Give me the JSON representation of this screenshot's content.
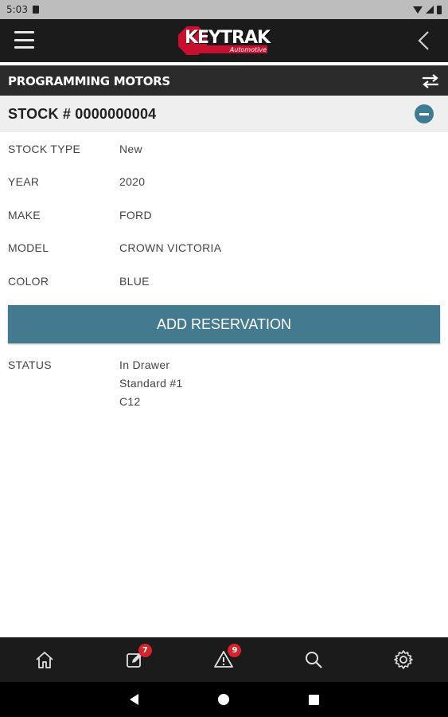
{
  "status_bar": {
    "time": "5:03"
  },
  "header": {
    "logo_text": "KEYTRAK",
    "logo_sub": "Automotive"
  },
  "dealer": {
    "name": "PROGRAMMING MOTORS"
  },
  "stock": {
    "title": "STOCK # 0000000004"
  },
  "details": [
    {
      "label": "STOCK TYPE",
      "value": "New"
    },
    {
      "label": "YEAR",
      "value": "2020"
    },
    {
      "label": "MAKE",
      "value": "FORD"
    },
    {
      "label": "MODEL",
      "value": "CROWN VICTORIA"
    },
    {
      "label": "COLOR",
      "value": "BLUE"
    }
  ],
  "reserve_button": {
    "label": "ADD RESERVATION"
  },
  "status": {
    "label": "STATUS",
    "lines": [
      "In Drawer",
      "Standard #1",
      "C12"
    ]
  },
  "bottom_nav": {
    "home": {
      "icon": "home-icon"
    },
    "tasks": {
      "icon": "edit-icon",
      "badge": "7"
    },
    "alerts": {
      "icon": "warning-icon",
      "badge": "9"
    },
    "search": {
      "icon": "search-icon"
    },
    "settings": {
      "icon": "gear-icon"
    }
  },
  "colors": {
    "accent": "#437a90",
    "brand_red": "#c8102e",
    "badge_red": "#d8232a",
    "header_bg": "#1b1b1b"
  }
}
